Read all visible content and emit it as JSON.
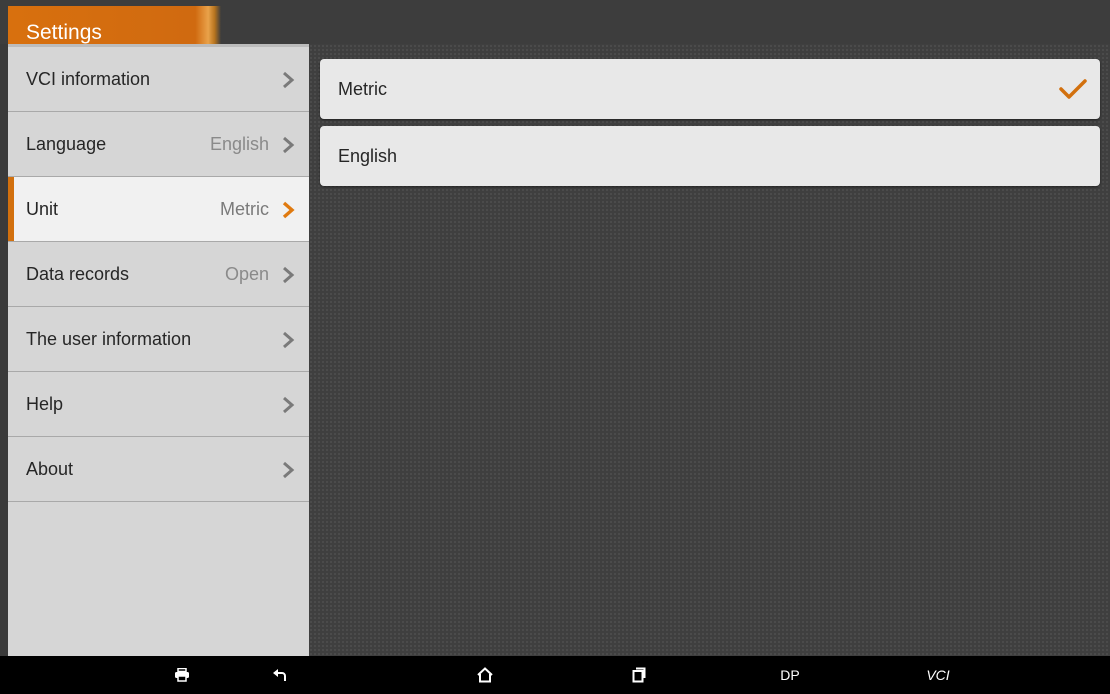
{
  "header": {
    "title": "Settings"
  },
  "sidebar": {
    "items": [
      {
        "label": "VCI information",
        "value": ""
      },
      {
        "label": "Language",
        "value": "English"
      },
      {
        "label": "Unit",
        "value": "Metric"
      },
      {
        "label": "Data records",
        "value": "Open"
      },
      {
        "label": "The user information",
        "value": ""
      },
      {
        "label": "Help",
        "value": ""
      },
      {
        "label": "About",
        "value": ""
      }
    ],
    "selected_index": 2
  },
  "main": {
    "options": [
      {
        "label": "Metric",
        "checked": true
      },
      {
        "label": "English",
        "checked": false
      }
    ]
  },
  "navbar": {
    "dp_label": "DP",
    "vci_label": "VCI"
  },
  "colors": {
    "accent": "#d2700e",
    "chevron": "#7a7a7a",
    "chevron_selected": "#e07a10"
  },
  "icons": [
    "chevron-right-icon",
    "checkmark-icon",
    "printer-icon",
    "back-icon",
    "home-icon",
    "recent-apps-icon"
  ]
}
